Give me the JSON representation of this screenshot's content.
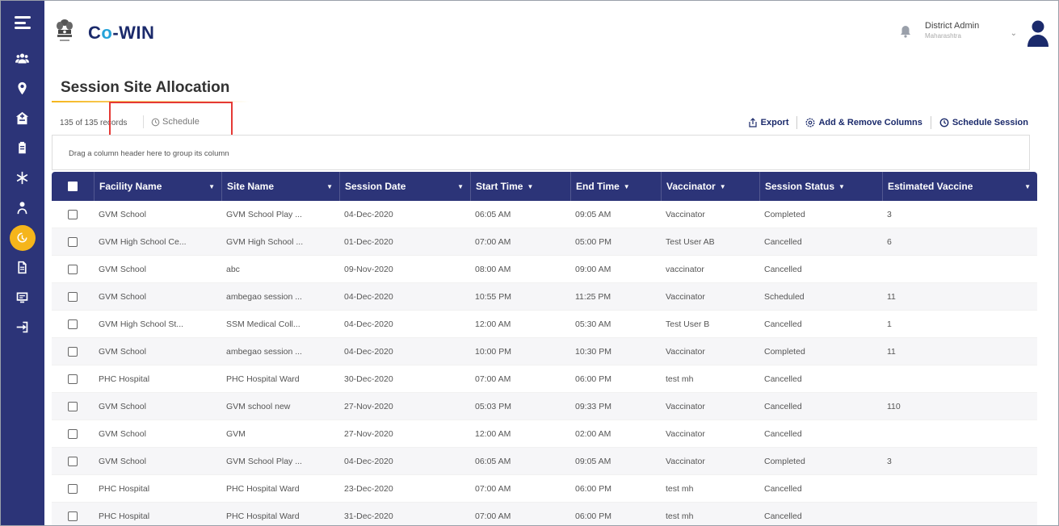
{
  "header": {
    "brand_prefix": "C",
    "brand_o": "o",
    "brand_suffix": "-WIN",
    "user_name": "District Admin",
    "user_state": "Maharashtra"
  },
  "page": {
    "title": "Session Site Allocation"
  },
  "toolbar": {
    "records": "135 of 135 records",
    "schedule_label": "Schedule",
    "export_label": "Export",
    "columns_label": "Add & Remove Columns",
    "schedule_session_label": "Schedule Session"
  },
  "group_panel": {
    "text": "Drag a column header here to group its column"
  },
  "table": {
    "columns": [
      "Facility Name",
      "Site Name",
      "Session Date",
      "Start Time",
      "End Time",
      "Vaccinator",
      "Session Status",
      "Estimated Vaccine"
    ],
    "rows": [
      [
        "GVM School",
        "GVM School Play ...",
        "04-Dec-2020",
        "06:05 AM",
        "09:05 AM",
        "Vaccinator",
        "Completed",
        "3"
      ],
      [
        "GVM High School Ce...",
        "GVM High School ...",
        "01-Dec-2020",
        "07:00 AM",
        "05:00 PM",
        "Test User AB",
        "Cancelled",
        "6"
      ],
      [
        "GVM School",
        "abc",
        "09-Nov-2020",
        "08:00 AM",
        "09:00 AM",
        "vaccinator",
        "Cancelled",
        ""
      ],
      [
        "GVM School",
        "ambegao session ...",
        "04-Dec-2020",
        "10:55 PM",
        "11:25 PM",
        "Vaccinator",
        "Scheduled",
        "11"
      ],
      [
        "GVM High School St...",
        "SSM Medical Coll...",
        "04-Dec-2020",
        "12:00 AM",
        "05:30 AM",
        "Test User B",
        "Cancelled",
        "1"
      ],
      [
        "GVM School",
        "ambegao session ...",
        "04-Dec-2020",
        "10:00 PM",
        "10:30 PM",
        "Vaccinator",
        "Completed",
        "11"
      ],
      [
        "PHC Hospital",
        "PHC Hospital Ward",
        "30-Dec-2020",
        "07:00 AM",
        "06:00 PM",
        "test mh",
        "Cancelled",
        ""
      ],
      [
        "GVM School",
        "GVM school new",
        "27-Nov-2020",
        "05:03 PM",
        "09:33 PM",
        "Vaccinator",
        "Cancelled",
        "110"
      ],
      [
        "GVM School",
        "GVM",
        "27-Nov-2020",
        "12:00 AM",
        "02:00 AM",
        "Vaccinator",
        "Cancelled",
        ""
      ],
      [
        "GVM School",
        "GVM School Play ...",
        "04-Dec-2020",
        "06:05 AM",
        "09:05 AM",
        "Vaccinator",
        "Completed",
        "3"
      ],
      [
        "PHC Hospital",
        "PHC Hospital Ward",
        "23-Dec-2020",
        "07:00 AM",
        "06:00 PM",
        "test mh",
        "Cancelled",
        ""
      ],
      [
        "PHC Hospital",
        "PHC Hospital Ward",
        "31-Dec-2020",
        "07:00 AM",
        "06:00 PM",
        "test mh",
        "Cancelled",
        ""
      ]
    ]
  },
  "sidebar": {
    "icons": [
      "users-icon",
      "location-pin-icon",
      "hospital-icon",
      "clipboard-icon",
      "asterisk-icon",
      "vaccinator-icon",
      "session-icon",
      "document-icon",
      "report-icon",
      "logout-icon"
    ],
    "active_index": 6
  },
  "colors": {
    "navy": "#2c3478",
    "accent": "#f5b51b",
    "highlight": "#e53935"
  }
}
